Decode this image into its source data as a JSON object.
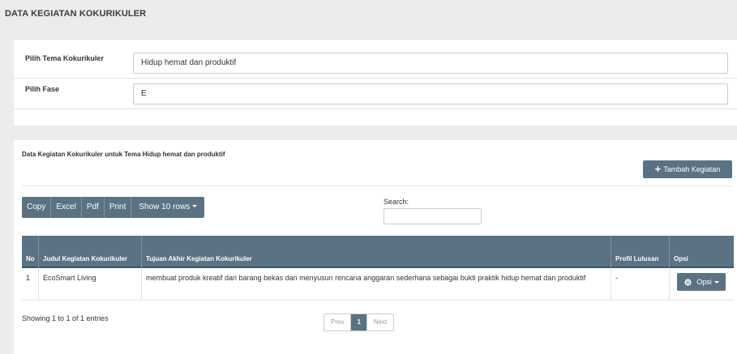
{
  "header": {
    "title": "DATA KEGIATAN KOKURIKULER"
  },
  "filter": {
    "tema_label": "Pilih Tema Kokurikuler",
    "tema_value": "Hidup hemat dan produktif",
    "fase_label": "Pilih Fase",
    "fase_value": "E"
  },
  "data_card": {
    "title": "Data Kegiatan Kokurikuler untuk Tema Hidup hemat dan produktif",
    "add_button": "Tambah Kegiatan",
    "add_icon": "plus-icon"
  },
  "toolbar": {
    "buttons": [
      "Copy",
      "Excel",
      "Pdf",
      "Print",
      "Show 10 rows"
    ]
  },
  "search": {
    "label": "Search:",
    "value": ""
  },
  "table": {
    "headers": [
      "No",
      "Judul Kegiatan Kokurikuler",
      "Tujuan Akhir Kegiatan Kokurikuler",
      "Profil Lulusan",
      "Opsi"
    ],
    "rows": [
      {
        "no": "1",
        "judul": "EcoSmart Living",
        "tujuan": "membuat produk kreatif dari barang bekas dan menyusun rencana anggaran sederhana sebagai bukti praktik hidup hemat dan produktif",
        "profil": "-",
        "opsi": "Opsi"
      }
    ]
  },
  "footer": {
    "info": "Showing 1 to 1 of 1 entries",
    "pagination": {
      "prev": "Prev",
      "current": "1",
      "next": "Next"
    }
  },
  "colors": {
    "accent": "#5b7282",
    "background": "#ececef"
  }
}
